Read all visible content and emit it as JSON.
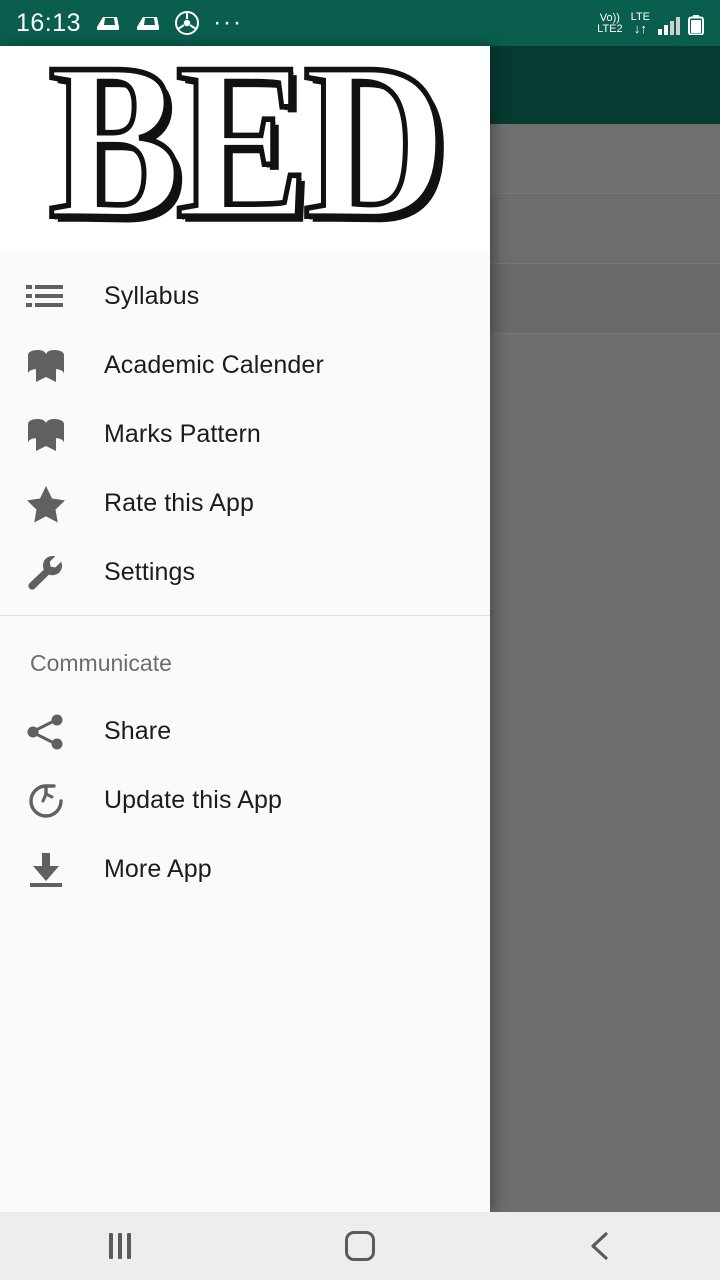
{
  "status_bar": {
    "time": "16:13",
    "icons": [
      "battery-saver-icon",
      "battery-saver-icon",
      "data-saver-icon",
      "more-notifications-icon"
    ],
    "volte_label": "Vo))",
    "sim_label": "LTE2",
    "network_label": "LTE",
    "data_arrows": "↓↑",
    "signal_icon": "signal-bars-icon",
    "battery_icon": "battery-icon"
  },
  "drawer": {
    "logo_text": "BED",
    "main_items": [
      {
        "label": "Syllabus",
        "icon": "list-icon"
      },
      {
        "label": "Academic Calender",
        "icon": "book-icon"
      },
      {
        "label": "Marks Pattern",
        "icon": "book-icon"
      },
      {
        "label": "Rate this App",
        "icon": "star-icon"
      },
      {
        "label": "Settings",
        "icon": "wrench-icon"
      }
    ],
    "section_title": "Communicate",
    "communicate_items": [
      {
        "label": "Share",
        "icon": "share-icon"
      },
      {
        "label": "Update this App",
        "icon": "refresh-icon"
      },
      {
        "label": "More App",
        "icon": "download-icon"
      }
    ]
  },
  "nav_bar": {
    "recents": "recents-button",
    "home": "home-button",
    "back": "back-button"
  },
  "colors": {
    "status_bar": "#0a5e4e",
    "app_bar": "#073b31",
    "drawer_bg": "#fafafa",
    "scrim": "#6e6e6e"
  }
}
